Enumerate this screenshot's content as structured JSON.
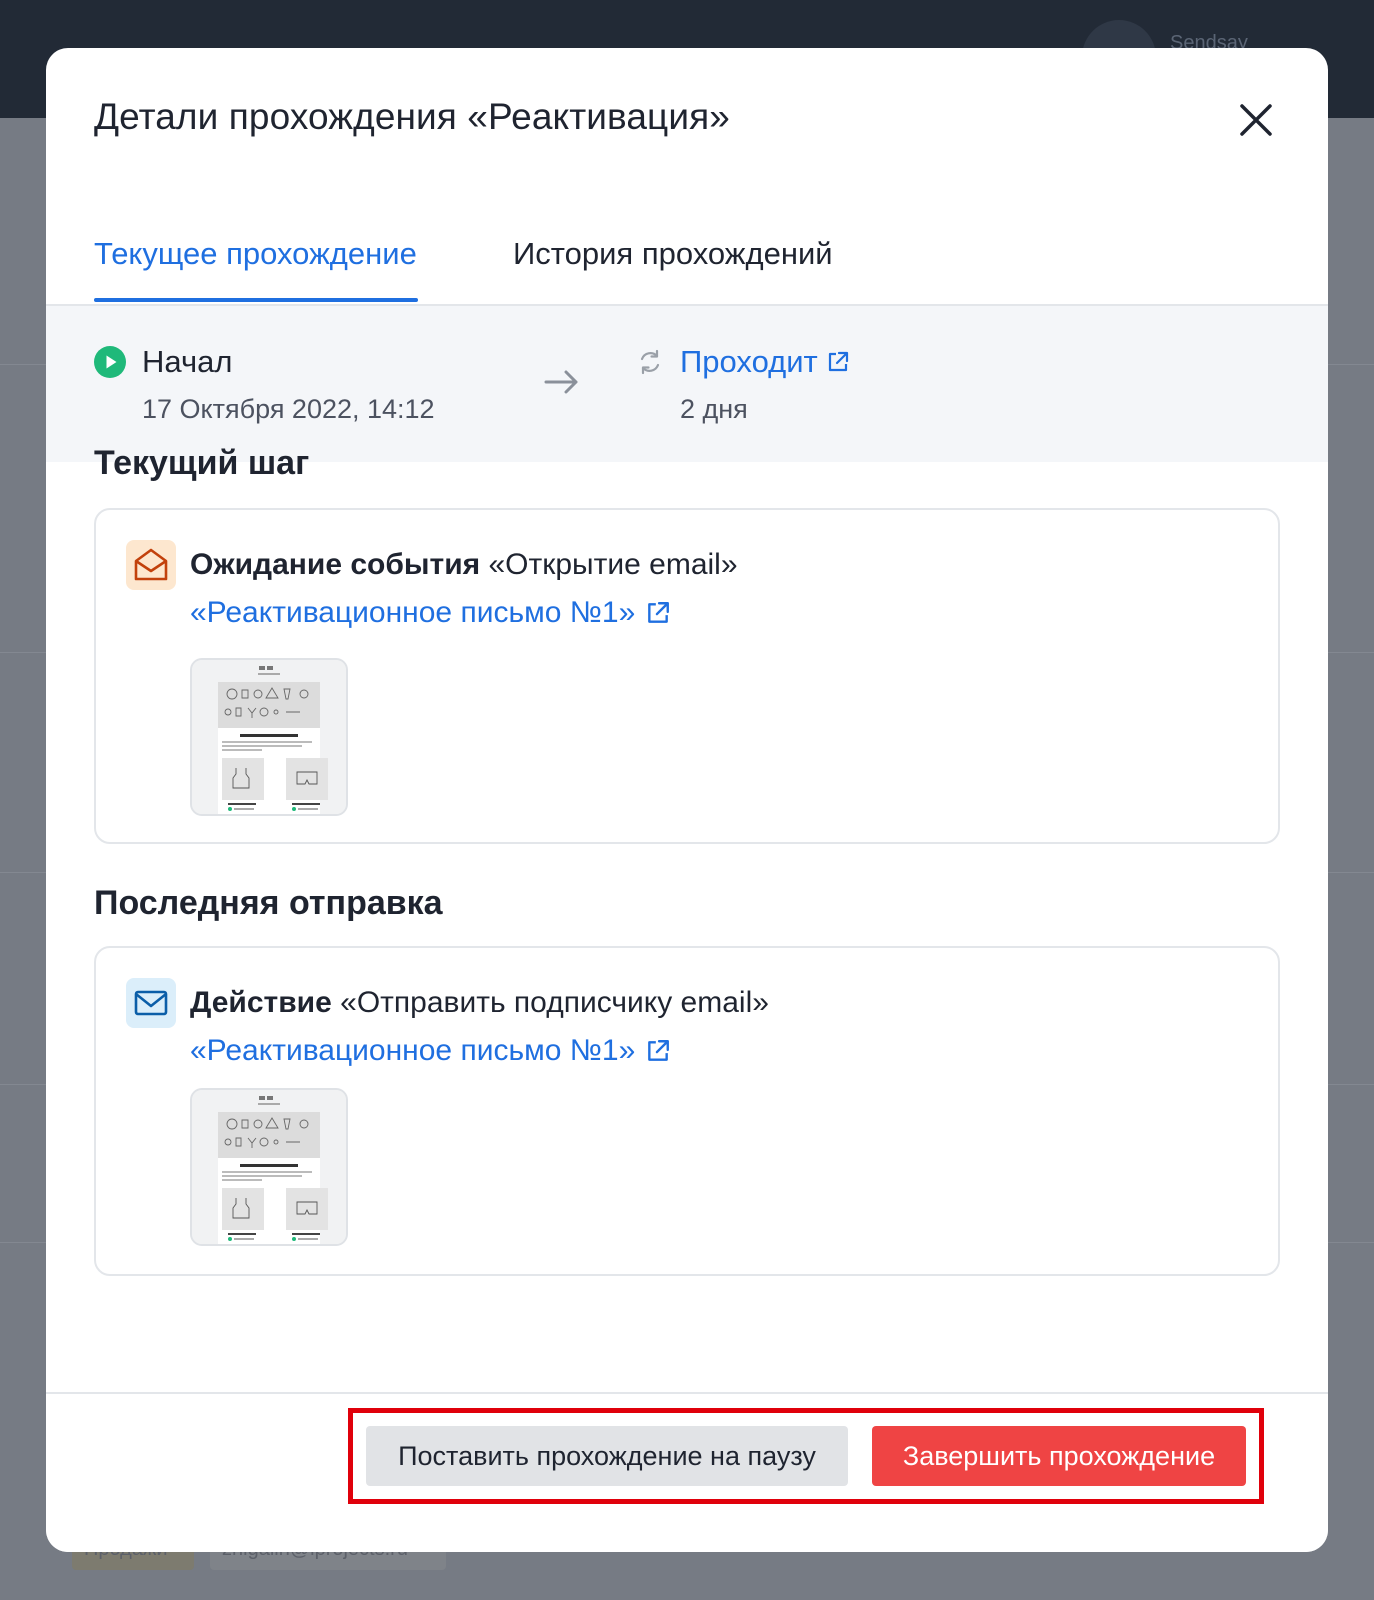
{
  "backdrop": {
    "brand": "Sendsay",
    "tags": [
      "Продажи",
      "zhigalin@iprojects.ru"
    ]
  },
  "modal": {
    "title": "Детали прохождения «Реактивация»",
    "close_icon": "close-icon"
  },
  "tabs": [
    {
      "label": "Текущее прохождение",
      "active": true
    },
    {
      "label": "История прохождений",
      "active": false
    }
  ],
  "status": {
    "start_label": "Начал",
    "start_date": "17 Октября 2022, 14:12",
    "progress_label": "Проходит",
    "duration": "2 дня",
    "start_icon": "play-icon",
    "progress_icon": "sync-icon",
    "accent": "#1f6fe0",
    "start_color": "#1fb97a"
  },
  "current_step": {
    "section_title": "Текущий шаг",
    "heading_bold": "Ожидание события",
    "heading_rest": " «Открытие email»",
    "link": "«Реактивационное письмо №1»",
    "icon": "open-envelope-icon",
    "icon_color": "#c2410c"
  },
  "last_send": {
    "section_title": "Последняя отправка",
    "heading_bold": "Действие",
    "heading_rest": " «Отправить подписчику email»",
    "link": "«Реактивационное письмо №1»",
    "icon": "envelope-icon",
    "icon_color": "#0b5ea8"
  },
  "footer": {
    "pause_button": "Поставить прохождение на паузу",
    "finish_button": "Завершить прохождение",
    "finish_color": "#ef4444",
    "highlight_color": "#e0000b"
  }
}
